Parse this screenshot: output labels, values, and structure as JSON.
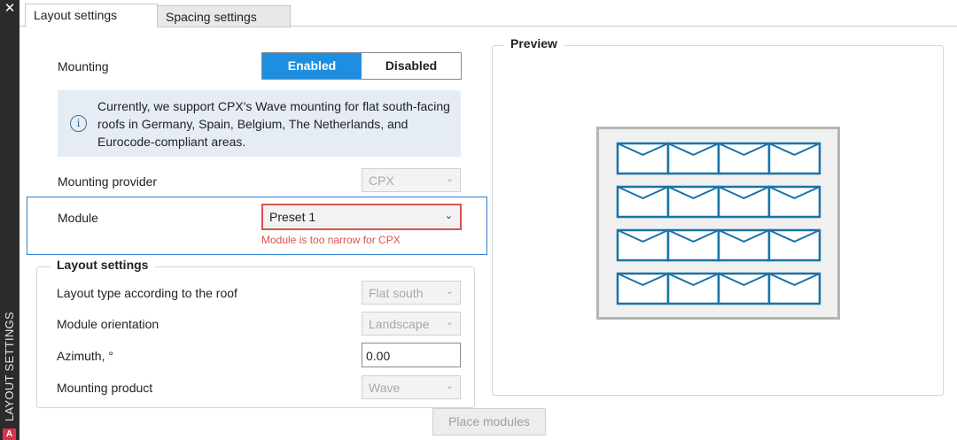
{
  "side_panel": {
    "close_symbol": "✕",
    "label": "LAYOUT SETTINGS",
    "badge": "A"
  },
  "tabs": [
    {
      "label": "Layout settings",
      "active": true
    },
    {
      "label": "Spacing settings",
      "active": false
    }
  ],
  "mounting": {
    "label": "Mounting",
    "options": [
      "Enabled",
      "Disabled"
    ],
    "selected": "Enabled"
  },
  "info": {
    "icon": "info-icon",
    "text": "Currently, we support CPX's Wave mounting for flat south-facing roofs in Germany, Spain, Belgium, The Netherlands, and Eurocode-compliant areas."
  },
  "mounting_provider": {
    "label": "Mounting provider",
    "value": "CPX"
  },
  "module": {
    "label": "Module",
    "value": "Preset 1",
    "error": "Module is too narrow for CPX"
  },
  "layout_group": {
    "title": "Layout settings",
    "layout_type": {
      "label": "Layout type according to the roof",
      "value": "Flat south"
    },
    "orientation": {
      "label": "Module orientation",
      "value": "Landscape"
    },
    "azimuth": {
      "label": "Azimuth, °",
      "value": "0.00"
    },
    "mounting_product": {
      "label": "Mounting product",
      "value": "Wave"
    }
  },
  "preview": {
    "title": "Preview",
    "rows": 4,
    "columns": 4
  },
  "place_button": {
    "label": "Place modules"
  },
  "colors": {
    "accent": "#1e8fe0",
    "error": "#d9534f",
    "selection": "#2f7fd0",
    "module_stroke": "#1a73a6",
    "info_bg": "#e5ecf4"
  }
}
